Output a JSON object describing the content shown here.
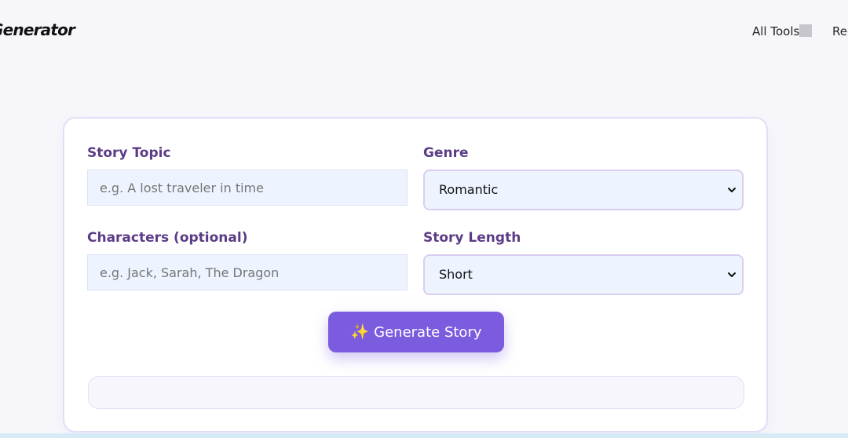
{
  "header": {
    "logo_text": "Generator",
    "nav": {
      "all_tools": "All Tools",
      "partial_link": "Rec"
    }
  },
  "form": {
    "topic": {
      "label": "Story Topic",
      "value": "",
      "placeholder": "e.g. A lost traveler in time"
    },
    "genre": {
      "label": "Genre",
      "selected": "Romantic"
    },
    "characters": {
      "label": "Characters (optional)",
      "value": "",
      "placeholder": "e.g. Jack, Sarah, The Dragon"
    },
    "length": {
      "label": "Story Length",
      "selected": "Short"
    },
    "generate_button": {
      "icon": "sparkles-icon",
      "label": "Generate Story"
    },
    "output": {
      "text": ""
    }
  },
  "colors": {
    "accent": "#7b5cdf",
    "label": "#5b3c86",
    "input_bg": "#eef4ff",
    "card_border": "#e6dcf7"
  }
}
